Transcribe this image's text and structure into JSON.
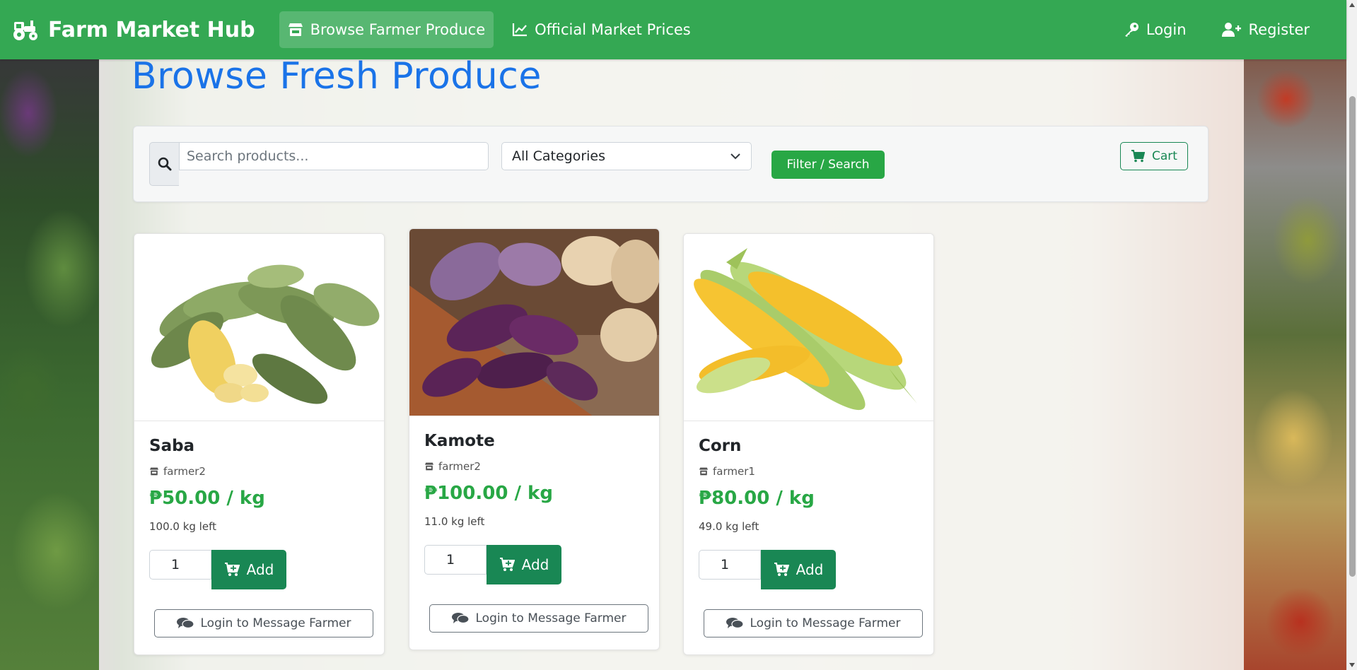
{
  "navbar": {
    "brand": "Farm Market Hub",
    "links": [
      {
        "label": "Browse Farmer Produce",
        "active": true,
        "icon": "store-icon"
      },
      {
        "label": "Official Market Prices",
        "active": false,
        "icon": "chart-line-icon"
      }
    ],
    "login_label": "Login",
    "register_label": "Register",
    "color": "#34a853"
  },
  "page": {
    "title": "Browse Fresh Produce"
  },
  "filters": {
    "search_placeholder": "Search products...",
    "search_value": "",
    "category_selected": "All Categories",
    "filter_button": "Filter / Search",
    "cart_button": "Cart"
  },
  "products": [
    {
      "name": "Saba",
      "farmer": "farmer2",
      "price": "₱50.00 / kg",
      "stock": "100.0 kg left",
      "qty": "1",
      "add_label": "Add",
      "message_label": "Login to Message Farmer",
      "image": "plantain-bananas"
    },
    {
      "name": "Kamote",
      "farmer": "farmer2",
      "price": "₱100.00 / kg",
      "stock": "11.0 kg left",
      "qty": "1",
      "add_label": "Add",
      "message_label": "Login to Message Farmer",
      "image": "sweet-potatoes"
    },
    {
      "name": "Corn",
      "farmer": "farmer1",
      "price": "₱80.00 / kg",
      "stock": "49.0 kg left",
      "qty": "1",
      "add_label": "Add",
      "message_label": "Login to Message Farmer",
      "image": "corn-cobs"
    }
  ],
  "colors": {
    "accent_green": "#28a745",
    "title_blue": "#1a73e8"
  }
}
